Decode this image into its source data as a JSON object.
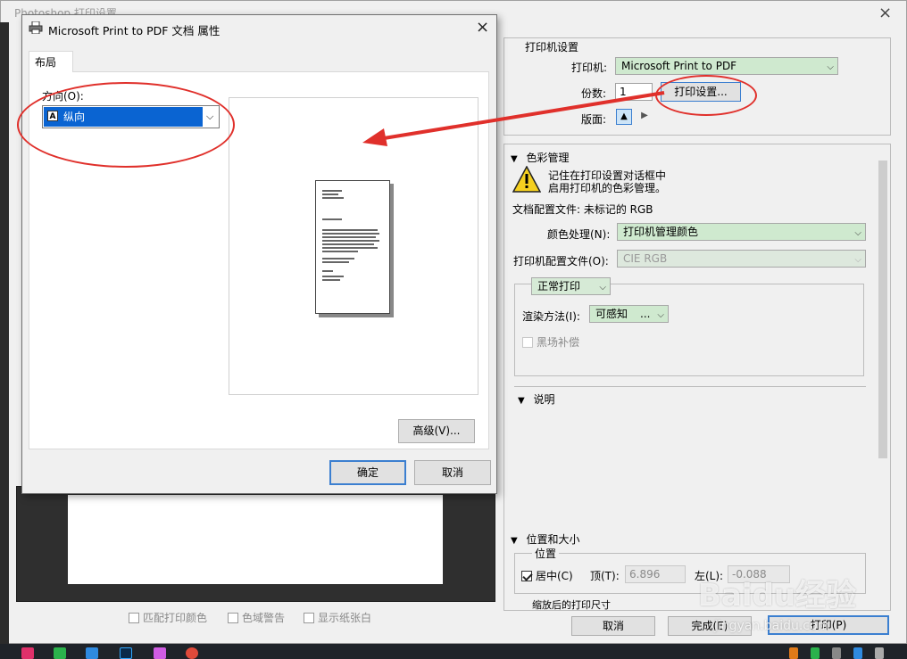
{
  "ps_window": {
    "title": "Photoshop 打印设置",
    "close_glyph": "×",
    "printer_settings": {
      "heading": "打印机设置",
      "printer_label": "打印机:",
      "printer_value": "Microsoft Print to PDF",
      "copies_label": "份数:",
      "copies_value": "1",
      "print_settings_button": "打印设置...",
      "layout_label": "版面:"
    },
    "color_management": {
      "heading": "色彩管理",
      "warning_line1": "记住在打印设置对话框中",
      "warning_line2": "启用打印机的色彩管理。",
      "doc_profile": "文档配置文件: 未标记的 RGB",
      "color_handling_label": "颜色处理(N):",
      "color_handling_value": "打印机管理颜色",
      "printer_profile_label": "打印机配置文件(O):",
      "printer_profile_value": "CIE RGB",
      "print_mode_value": "正常打印",
      "render_intent_label": "渲染方法(I):",
      "render_intent_value": "可感知",
      "black_point_label": "黑场补偿"
    },
    "description": {
      "heading": "说明"
    },
    "position_size": {
      "heading": "位置和大小",
      "position_label": "位置",
      "center_label": "居中(C)",
      "top_label": "顶(T):",
      "top_value": "6.896",
      "left_label": "左(L):",
      "left_value": "-0.088",
      "scaled_label": "缩放后的打印尺寸"
    },
    "bottom_checks": {
      "match_colors": "匹配打印颜色",
      "gamut_warning": "色域警告",
      "show_paper_white": "显示纸张白"
    },
    "buttons": {
      "cancel": "取消",
      "done": "完成(E)",
      "print": "打印(P)"
    }
  },
  "props_dialog": {
    "title": "Microsoft Print to PDF 文档 属性",
    "close_glyph": "×",
    "tab_layout": "布局",
    "orientation_label": "方向(O):",
    "orientation_value": "纵向",
    "advanced_button": "高级(V)...",
    "ok_button": "确定",
    "cancel_button": "取消"
  },
  "watermark": {
    "brand": "Baidu经验",
    "url": "jingyan.baidu.com"
  },
  "colors": {
    "annotation_red": "#e0302b",
    "combo_green": "#cfe9cf",
    "selection_blue": "#0a64d2",
    "taskbar": "#1f2329"
  }
}
